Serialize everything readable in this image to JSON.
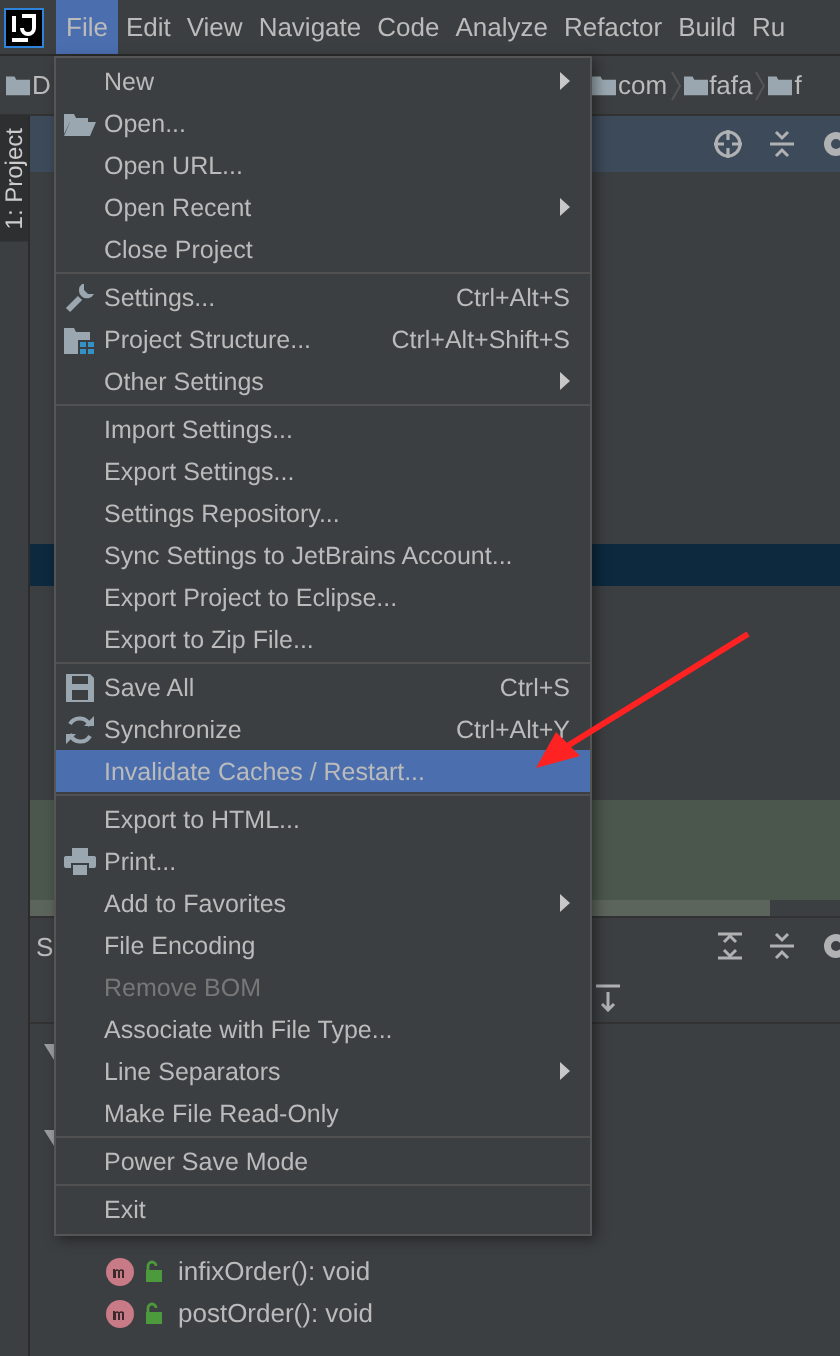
{
  "menubar": [
    {
      "label": "File",
      "selected": true
    },
    {
      "label": "Edit",
      "selected": false
    },
    {
      "label": "View",
      "selected": false
    },
    {
      "label": "Navigate",
      "selected": false
    },
    {
      "label": "Code",
      "selected": false
    },
    {
      "label": "Analyze",
      "selected": false
    },
    {
      "label": "Refactor",
      "selected": false
    },
    {
      "label": "Build",
      "selected": false
    },
    {
      "label": "Ru",
      "selected": false
    }
  ],
  "breadcrumbs": [
    "D",
    "com",
    "fafa",
    "f"
  ],
  "side_tab": {
    "label": "1: Project"
  },
  "structure_panel": {
    "title": "S"
  },
  "methods": [
    {
      "label": "infixOrder(): void"
    },
    {
      "label": "postOrder(): void"
    }
  ],
  "file_menu": {
    "sections": [
      [
        {
          "label": "New",
          "submenu": true,
          "disabled": false,
          "selected": false
        },
        {
          "label": "Open...",
          "submenu": false,
          "disabled": false,
          "selected": false
        },
        {
          "label": "Open URL...",
          "submenu": false,
          "disabled": false,
          "selected": false
        },
        {
          "label": "Open Recent",
          "submenu": true,
          "disabled": false,
          "selected": false
        },
        {
          "label": "Close Project",
          "submenu": false,
          "disabled": false,
          "selected": false
        }
      ],
      [
        {
          "label": "Settings...",
          "shortcut": "Ctrl+Alt+S",
          "submenu": false,
          "disabled": false,
          "selected": false
        },
        {
          "label": "Project Structure...",
          "shortcut": "Ctrl+Alt+Shift+S",
          "submenu": false,
          "disabled": false,
          "selected": false
        },
        {
          "label": "Other Settings",
          "submenu": true,
          "disabled": false,
          "selected": false
        }
      ],
      [
        {
          "label": "Import Settings...",
          "submenu": false,
          "disabled": false,
          "selected": false
        },
        {
          "label": "Export Settings...",
          "submenu": false,
          "disabled": false,
          "selected": false
        },
        {
          "label": "Settings Repository...",
          "submenu": false,
          "disabled": false,
          "selected": false
        },
        {
          "label": "Sync Settings to JetBrains Account...",
          "submenu": false,
          "disabled": false,
          "selected": false
        },
        {
          "label": "Export Project to Eclipse...",
          "submenu": false,
          "disabled": false,
          "selected": false
        },
        {
          "label": "Export to Zip File...",
          "submenu": false,
          "disabled": false,
          "selected": false
        }
      ],
      [
        {
          "label": "Save All",
          "shortcut": "Ctrl+S",
          "submenu": false,
          "disabled": false,
          "selected": false
        },
        {
          "label": "Synchronize",
          "shortcut": "Ctrl+Alt+Y",
          "submenu": false,
          "disabled": false,
          "selected": false
        },
        {
          "label": "Invalidate Caches / Restart...",
          "submenu": false,
          "disabled": false,
          "selected": true
        }
      ],
      [
        {
          "label": "Export to HTML...",
          "submenu": false,
          "disabled": false,
          "selected": false
        },
        {
          "label": "Print...",
          "submenu": false,
          "disabled": false,
          "selected": false
        },
        {
          "label": "Add to Favorites",
          "submenu": true,
          "disabled": false,
          "selected": false
        },
        {
          "label": "File Encoding",
          "submenu": false,
          "disabled": false,
          "selected": false
        },
        {
          "label": "Remove BOM",
          "submenu": false,
          "disabled": true,
          "selected": false
        },
        {
          "label": "Associate with File Type...",
          "submenu": false,
          "disabled": false,
          "selected": false
        },
        {
          "label": "Line Separators",
          "submenu": true,
          "disabled": false,
          "selected": false
        },
        {
          "label": "Make File Read-Only",
          "submenu": false,
          "disabled": false,
          "selected": false
        }
      ],
      [
        {
          "label": "Power Save Mode",
          "submenu": false,
          "disabled": false,
          "selected": false
        }
      ],
      [
        {
          "label": "Exit",
          "submenu": false,
          "disabled": false,
          "selected": false
        }
      ]
    ]
  }
}
